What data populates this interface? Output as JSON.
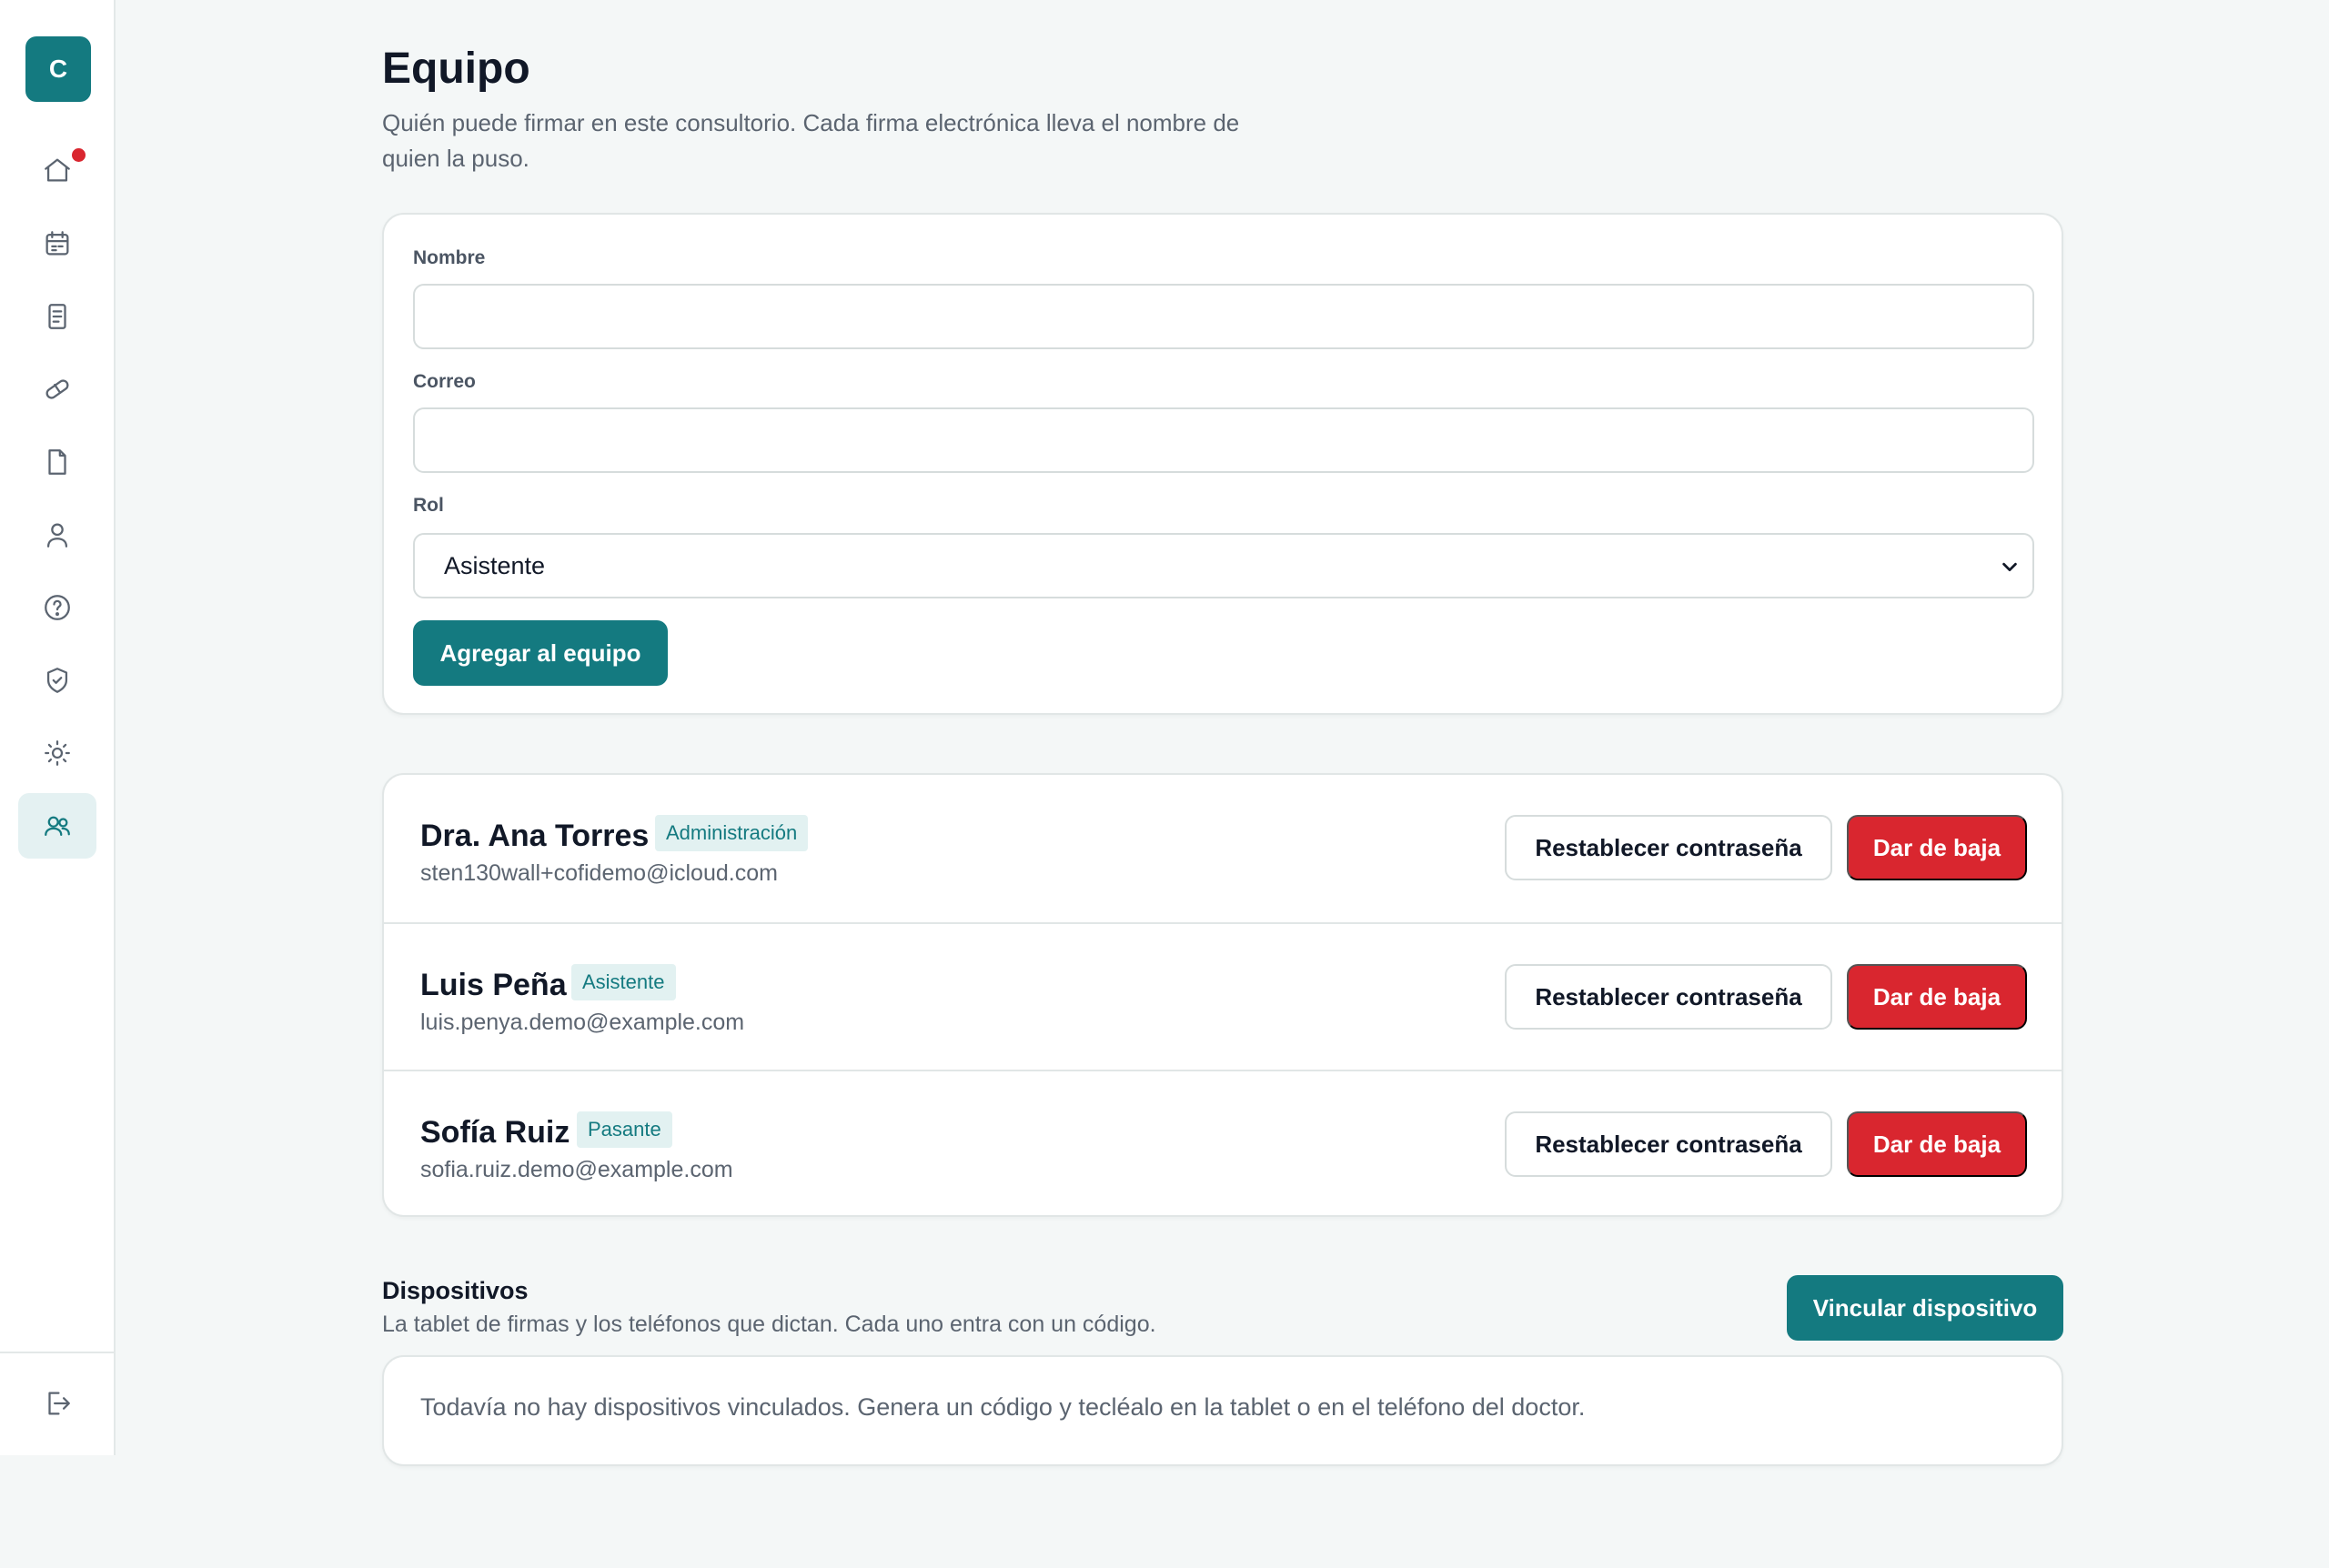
{
  "sidebar": {
    "logo_letter": "C",
    "items": [
      {
        "icon": "home-icon",
        "active": false,
        "has_notification": true
      },
      {
        "icon": "calendar-icon",
        "active": false
      },
      {
        "icon": "document-list-icon",
        "active": false
      },
      {
        "icon": "pill-icon",
        "active": false
      },
      {
        "icon": "file-icon",
        "active": false
      },
      {
        "icon": "user-icon",
        "active": false
      },
      {
        "icon": "help-icon",
        "active": false
      },
      {
        "icon": "shield-check-icon",
        "active": false
      },
      {
        "icon": "sun-icon",
        "active": false
      },
      {
        "icon": "users-icon",
        "active": true
      }
    ],
    "logout_icon": "logout-icon"
  },
  "colors": {
    "primary": "#147a80",
    "danger": "#d9262f",
    "badge_bg": "#e2f1f1",
    "page_bg": "#f4f7f7"
  },
  "header": {
    "title": "Equipo",
    "subtitle": "Quién puede firmar en este consultorio. Cada firma electrónica lleva el nombre de quien la puso."
  },
  "form": {
    "name_label": "Nombre",
    "name_value": "",
    "email_label": "Correo",
    "email_value": "",
    "role_label": "Rol",
    "role_selected": "Asistente",
    "submit_label": "Agregar al equipo"
  },
  "members": [
    {
      "name": "Dra. Ana Torres",
      "role": "Administración",
      "email": "sten130wall+cofidemo@icloud.com",
      "reset_label": "Restablecer contraseña",
      "remove_label": "Dar de baja"
    },
    {
      "name": "Luis Peña",
      "role": "Asistente",
      "email": "luis.penya.demo@example.com",
      "reset_label": "Restablecer contraseña",
      "remove_label": "Dar de baja"
    },
    {
      "name": "Sofía Ruiz",
      "role": "Pasante",
      "email": "sofia.ruiz.demo@example.com",
      "reset_label": "Restablecer contraseña",
      "remove_label": "Dar de baja"
    }
  ],
  "devices": {
    "title": "Dispositivos",
    "subtitle": "La tablet de firmas y los teléfonos que dictan. Cada uno entra con un código.",
    "link_button_label": "Vincular dispositivo",
    "empty_message": "Todavía no hay dispositivos vinculados. Genera un código y tecléalo en la tablet o en el teléfono del doctor."
  }
}
